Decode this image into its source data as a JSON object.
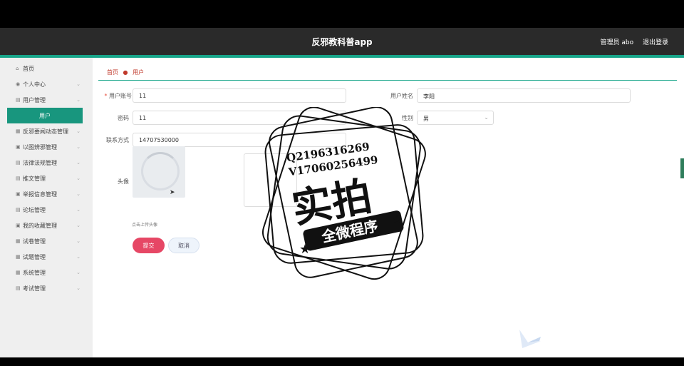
{
  "app": {
    "title": "反邪教科普app",
    "admin_label": "管理员 abo",
    "logout_label": "退出登录"
  },
  "sidebar": {
    "items": [
      {
        "label": "首页",
        "icon": "home-icon",
        "glyph": "⌂",
        "expandable": false
      },
      {
        "label": "个人中心",
        "icon": "user-icon",
        "glyph": "◉",
        "expandable": true
      },
      {
        "label": "用户管理",
        "icon": "folder-icon",
        "glyph": "▤",
        "expandable": true
      },
      {
        "label": "用户",
        "icon": "",
        "glyph": "",
        "expandable": false,
        "active": true
      },
      {
        "label": "反邪要闻动态管理",
        "icon": "grid-icon",
        "glyph": "▦",
        "expandable": true
      },
      {
        "label": "以图辨邪管理",
        "icon": "image-icon",
        "glyph": "▣",
        "expandable": true
      },
      {
        "label": "法律法规管理",
        "icon": "book-icon",
        "glyph": "▤",
        "expandable": true
      },
      {
        "label": "推文管理",
        "icon": "doc-icon",
        "glyph": "▤",
        "expandable": true
      },
      {
        "label": "举报信息管理",
        "icon": "report-icon",
        "glyph": "▣",
        "expandable": true
      },
      {
        "label": "论坛管理",
        "icon": "forum-icon",
        "glyph": "▤",
        "expandable": true
      },
      {
        "label": "我的收藏管理",
        "icon": "star-icon",
        "glyph": "▣",
        "expandable": true
      },
      {
        "label": "试卷管理",
        "icon": "paper-icon",
        "glyph": "▦",
        "expandable": true
      },
      {
        "label": "试题管理",
        "icon": "question-icon",
        "glyph": "▦",
        "expandable": true
      },
      {
        "label": "系统管理",
        "icon": "settings-icon",
        "glyph": "▦",
        "expandable": true
      },
      {
        "label": "考试管理",
        "icon": "exam-icon",
        "glyph": "▤",
        "expandable": true
      }
    ]
  },
  "breadcrumb": {
    "home": "首页",
    "current": "用户"
  },
  "form": {
    "account_label": "用户账号",
    "account_value": "11",
    "name_label": "用户姓名",
    "name_value": "李阳",
    "password_label": "密码",
    "password_value": "11",
    "gender_label": "性别",
    "gender_value": "男",
    "contact_label": "联系方式",
    "contact_value": "14707530000",
    "avatar_label": "头像",
    "upload_hint": "点击上传头像",
    "submit_label": "提交",
    "cancel_label": "取消"
  },
  "watermark": {
    "qq": "Q2196316269",
    "vx": "V17060256499",
    "main": "实拍",
    "sub": "全微程序"
  },
  "colors": {
    "accent": "#17a589",
    "active_nav": "#18967e",
    "submit": "#e64765",
    "topbar": "#2a2a2a"
  }
}
